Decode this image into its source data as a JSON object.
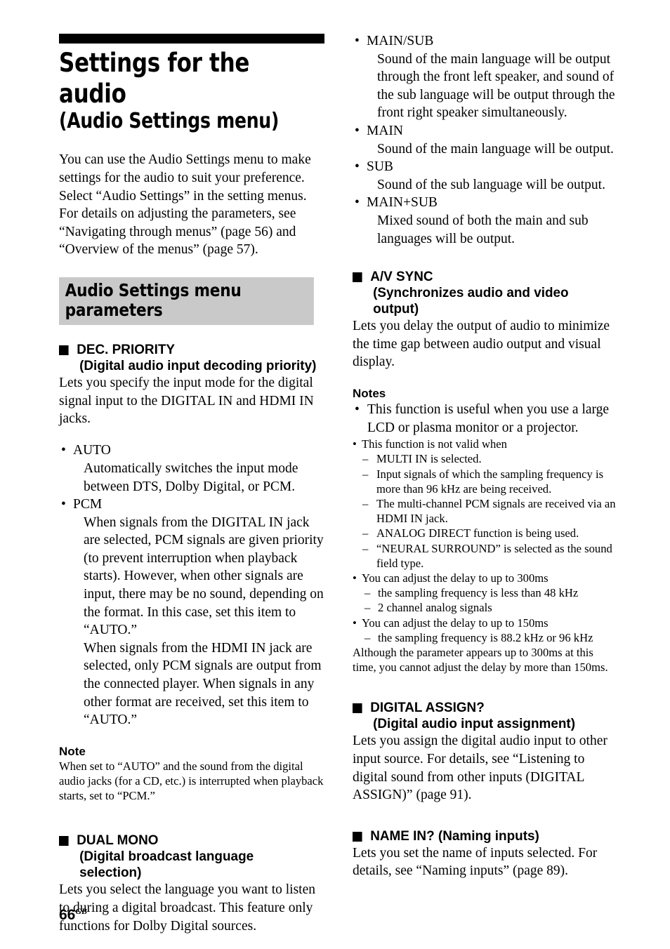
{
  "page": {
    "number": "66",
    "region_mark": "GB"
  },
  "title": {
    "line1": "Settings for the audio",
    "line2": "(Audio Settings menu)"
  },
  "intro": "You can use the Audio Settings menu to make settings for the audio to suit your preference. Select “Audio Settings” in the setting menus. For details on adjusting the parameters, see “Navigating through menus” (page 56) and “Overview of the menus” (page 57).",
  "section_bar": {
    "label": "Audio Settings menu parameters",
    "background_color": "#c9c9c9"
  },
  "bullet_glyph": "•",
  "dash_glyph": "–",
  "square_glyph": "■",
  "dec_priority": {
    "heading_main": "DEC. PRIORITY",
    "heading_sub": "(Digital audio input decoding priority)",
    "intro": "Lets you specify the input mode for the digital signal input to the DIGITAL IN and HDMI IN jacks.",
    "options": [
      {
        "label": "AUTO",
        "desc": "Automatically switches the input mode between DTS, Dolby Digital, or PCM."
      },
      {
        "label": "PCM",
        "desc": "When signals from the DIGITAL IN jack are selected, PCM signals are given priority (to prevent interruption when playback starts). However, when other signals are input, there may be no sound, depending on the format. In this case, set this item to “AUTO.”",
        "desc2": "When signals from the HDMI IN jack are selected, only PCM signals are output from the connected player. When signals in any other format are received, set this item to “AUTO.”"
      }
    ],
    "note_heading": "Note",
    "note_body": "When set to “AUTO” and the sound from the digital audio jacks (for a CD, etc.) is interrupted when playback starts, set to “PCM.”"
  },
  "dual_mono": {
    "heading_main": "DUAL MONO",
    "heading_sub": "(Digital broadcast language selection)",
    "intro": "Lets you select the language you want to listen to during a digital broadcast. This feature only functions for Dolby Digital sources.",
    "options": [
      {
        "label": "MAIN/SUB",
        "desc": "Sound of the main language will be output through the front left speaker, and sound of the sub language will be output through the front right speaker simultaneously."
      },
      {
        "label": "MAIN",
        "desc": "Sound of the main language will be output."
      },
      {
        "label": "SUB",
        "desc": "Sound of the sub language will be output."
      },
      {
        "label": "MAIN+SUB",
        "desc": "Mixed sound of both the main and sub languages will be output."
      }
    ]
  },
  "av_sync": {
    "heading_main": "A/V SYNC",
    "heading_sub": "(Synchronizes audio and video output)",
    "intro": "Lets you delay the output of audio to minimize the time gap between audio output and visual display.",
    "notes_heading": "Notes",
    "note_large": "This function is useful when you use a large LCD or plasma monitor or a projector.",
    "note_not_valid": "This function is not valid when",
    "not_valid_items": [
      "MULTI IN is selected.",
      "Input signals of which the sampling frequency is more than 96 kHz are being received.",
      "The multi-channel PCM signals are received via an HDMI IN jack.",
      "ANALOG DIRECT function is being used.",
      "“NEURAL SURROUND” is selected as the sound field type."
    ],
    "note_300ms": "You can adjust the delay to up to 300ms",
    "items_300ms": [
      "the sampling frequency is less than 48 kHz",
      "2 channel analog signals"
    ],
    "note_150ms": "You can adjust the delay to up to 150ms",
    "items_150ms": [
      "the sampling frequency is 88.2 kHz or 96 kHz"
    ],
    "tail": "Although the parameter appears up to 300ms at this time, you cannot adjust the delay by more than 150ms."
  },
  "digital_assign": {
    "heading_main": "DIGITAL ASSIGN?",
    "heading_sub": "(Digital audio input assignment)",
    "body": "Lets you assign the digital audio input to other input source. For details, see “Listening to digital sound from other inputs (DIGITAL ASSIGN)” (page 91)."
  },
  "name_in": {
    "heading": "NAME IN? (Naming inputs)",
    "body": "Lets you set the name of inputs selected. For details, see “Naming inputs” (page 89)."
  }
}
